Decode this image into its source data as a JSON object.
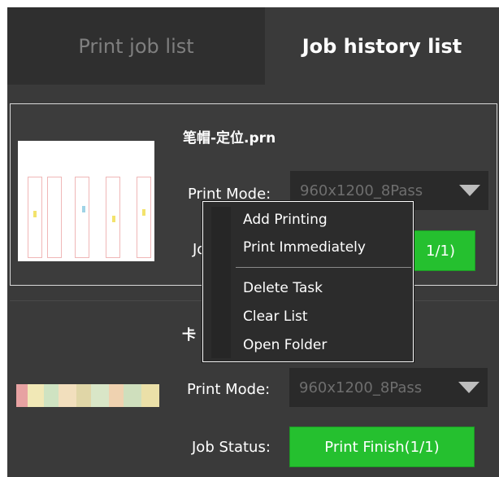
{
  "tabs": {
    "print_job_list": "Print job list",
    "job_history_list": "Job history list"
  },
  "jobs": [
    {
      "filename": "笔帽-定位.prn",
      "print_mode_label": "Print Mode:",
      "print_mode_value": "960x1200_8Pass",
      "job_status_label_partial": "Jo",
      "job_status_value_partial": "1/1)"
    },
    {
      "filename_partial": "卡",
      "print_mode_label": "Print Mode:",
      "print_mode_value": "960x1200_8Pass",
      "job_status_label": "Job Status:",
      "job_status_value": "Print Finish(1/1)"
    }
  ],
  "context_menu": {
    "items": [
      "Add Printing",
      "Print Immediately",
      "Delete Task",
      "Clear List",
      "Open Folder"
    ]
  },
  "colors": {
    "status_green": "#25c02f",
    "background": "#3a3a3a"
  }
}
